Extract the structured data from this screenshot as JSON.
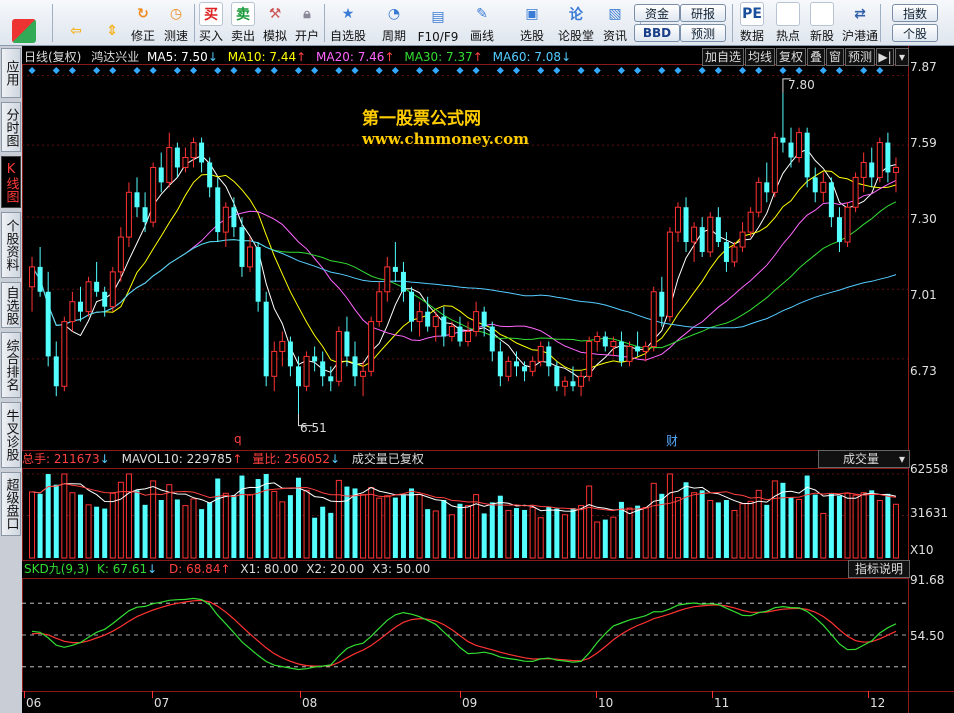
{
  "toolbar": {
    "buttons": [
      {
        "label": "",
        "icon": "grid-icon"
      },
      {
        "label": "",
        "icon": "back-arrow-icon"
      },
      {
        "label": "",
        "icon": "up-down-arrows-icon"
      },
      {
        "label": "修正",
        "icon": "refresh-icon"
      },
      {
        "label": "测速",
        "icon": "clock-icon"
      },
      {
        "label": "买入",
        "icon": "buy-icon",
        "glyph": "买"
      },
      {
        "label": "卖出",
        "icon": "sell-icon",
        "glyph": "卖"
      },
      {
        "label": "模拟",
        "icon": "hammer-icon"
      },
      {
        "label": "开户",
        "icon": "lock-icon"
      },
      {
        "label": "自选股",
        "icon": "star-folder-icon"
      },
      {
        "label": "周期",
        "icon": "period-icon"
      },
      {
        "label": "F10/F9",
        "icon": "f10-icon"
      },
      {
        "label": "画线",
        "icon": "pen-icon"
      },
      {
        "label": "选股",
        "icon": "screen-icon"
      },
      {
        "label": "论股堂",
        "icon": "forum-icon"
      },
      {
        "label": "资讯",
        "icon": "news-icon"
      },
      {
        "label": "数据",
        "icon": "pe-icon",
        "glyph": "PE"
      },
      {
        "label": "热点",
        "icon": "hot-icon"
      },
      {
        "label": "新股",
        "icon": "new-stock-icon"
      },
      {
        "label": "沪港通",
        "icon": "sse-hkex-icon"
      }
    ],
    "pills": {
      "fund": "资金",
      "bbd": "BBD",
      "research": "研报",
      "forecast": "预测",
      "index": "指数",
      "stock": "个股"
    }
  },
  "left_tabs": [
    {
      "label": "应用",
      "active": false
    },
    {
      "label": "分时图",
      "active": false
    },
    {
      "label": "K线图",
      "active": true
    },
    {
      "label": "个股资料",
      "active": false
    },
    {
      "label": "自选股",
      "active": false
    },
    {
      "label": "综合排名",
      "active": false
    },
    {
      "label": "牛叉诊股",
      "active": false
    },
    {
      "label": "超级盘口",
      "active": false
    }
  ],
  "header": {
    "period": "日线(复权)",
    "stock_name": "鸿达兴业",
    "ma5": "MA5: 7.50",
    "ma5_arrow": "↓",
    "ma10": "MA10: 7.44",
    "ma10_arrow": "↑",
    "ma20": "MA20: 7.46",
    "ma20_arrow": "↑",
    "ma30": "MA30: 7.37",
    "ma30_arrow": "↑",
    "ma60": "MA60: 7.08",
    "ma60_arrow": "↓",
    "buttons": [
      "加自选",
      "均线",
      "复权",
      "叠",
      "窗",
      "预测"
    ],
    "colors": {
      "ma5": "#ffffff",
      "ma10": "#ffff00",
      "ma20": "#ff66ff",
      "ma30": "#33dd33",
      "ma60": "#55ccff"
    }
  },
  "watermark": {
    "title": "第一股票公式网",
    "url": "www.chnmoney.com"
  },
  "price_panel": {
    "y_ticks": [
      "7.87",
      "7.59",
      "7.30",
      "7.01",
      "6.73"
    ],
    "high_label": "7.80",
    "low_label": "6.51",
    "markers": {
      "q": "q",
      "cai": "财"
    }
  },
  "volume_panel": {
    "total": "总手: 211673",
    "total_arrow": "↓",
    "mavol": "MAVOL10: 229785",
    "mavol_arrow": "↑",
    "ratio": "量比: 256052",
    "ratio_arrow": "↓",
    "note": "成交量已复权",
    "selector": "成交量",
    "y_ticks": [
      "62558",
      "31631"
    ],
    "unit": "X10"
  },
  "skd_panel": {
    "name": "SKD九(9,3)",
    "k": "K: 67.61",
    "k_arrow": "↓",
    "d": "D: 68.84",
    "d_arrow": "↑",
    "x1": "X1: 80.00",
    "x2": "X2: 20.00",
    "x3": "X3: 50.00",
    "explain": "指标说明",
    "y_ticks": [
      "91.68",
      "54.50"
    ]
  },
  "x_axis": [
    "06",
    "07",
    "08",
    "09",
    "10",
    "11",
    "12"
  ],
  "chart_data": {
    "type": "candlestick",
    "stock": "鸿达兴业",
    "price_range": [
      6.51,
      7.8
    ],
    "candles": [
      {
        "o": 7.02,
        "h": 7.14,
        "l": 6.92,
        "c": 7.1
      },
      {
        "o": 7.1,
        "h": 7.18,
        "l": 6.98,
        "c": 7.0
      },
      {
        "o": 7.0,
        "h": 7.08,
        "l": 6.7,
        "c": 6.74
      },
      {
        "o": 6.74,
        "h": 6.8,
        "l": 6.58,
        "c": 6.62
      },
      {
        "o": 6.62,
        "h": 6.9,
        "l": 6.6,
        "c": 6.88
      },
      {
        "o": 6.88,
        "h": 7.0,
        "l": 6.84,
        "c": 6.96
      },
      {
        "o": 6.96,
        "h": 7.02,
        "l": 6.88,
        "c": 6.92
      },
      {
        "o": 6.92,
        "h": 7.06,
        "l": 6.9,
        "c": 7.04
      },
      {
        "o": 7.04,
        "h": 7.12,
        "l": 6.98,
        "c": 7.0
      },
      {
        "o": 7.0,
        "h": 7.02,
        "l": 6.9,
        "c": 6.94
      },
      {
        "o": 6.94,
        "h": 7.1,
        "l": 6.92,
        "c": 7.08
      },
      {
        "o": 7.08,
        "h": 7.26,
        "l": 7.04,
        "c": 7.22
      },
      {
        "o": 7.22,
        "h": 7.44,
        "l": 7.18,
        "c": 7.4
      },
      {
        "o": 7.4,
        "h": 7.46,
        "l": 7.3,
        "c": 7.34
      },
      {
        "o": 7.34,
        "h": 7.4,
        "l": 7.24,
        "c": 7.28
      },
      {
        "o": 7.28,
        "h": 7.52,
        "l": 7.26,
        "c": 7.5
      },
      {
        "o": 7.5,
        "h": 7.56,
        "l": 7.4,
        "c": 7.44
      },
      {
        "o": 7.44,
        "h": 7.64,
        "l": 7.42,
        "c": 7.58
      },
      {
        "o": 7.58,
        "h": 7.6,
        "l": 7.46,
        "c": 7.5
      },
      {
        "o": 7.5,
        "h": 7.58,
        "l": 7.48,
        "c": 7.54
      },
      {
        "o": 7.54,
        "h": 7.62,
        "l": 7.5,
        "c": 7.6
      },
      {
        "o": 7.6,
        "h": 7.62,
        "l": 7.48,
        "c": 7.52
      },
      {
        "o": 7.52,
        "h": 7.54,
        "l": 7.38,
        "c": 7.42
      },
      {
        "o": 7.42,
        "h": 7.46,
        "l": 7.2,
        "c": 7.24
      },
      {
        "o": 7.24,
        "h": 7.36,
        "l": 7.18,
        "c": 7.34
      },
      {
        "o": 7.34,
        "h": 7.38,
        "l": 7.22,
        "c": 7.26
      },
      {
        "o": 7.26,
        "h": 7.3,
        "l": 7.06,
        "c": 7.1
      },
      {
        "o": 7.1,
        "h": 7.22,
        "l": 7.08,
        "c": 7.18
      },
      {
        "o": 7.18,
        "h": 7.2,
        "l": 6.92,
        "c": 6.96
      },
      {
        "o": 6.96,
        "h": 7.0,
        "l": 6.62,
        "c": 6.66
      },
      {
        "o": 6.66,
        "h": 6.8,
        "l": 6.6,
        "c": 6.76
      },
      {
        "o": 6.76,
        "h": 6.84,
        "l": 6.7,
        "c": 6.8
      },
      {
        "o": 6.8,
        "h": 6.82,
        "l": 6.66,
        "c": 6.7
      },
      {
        "o": 6.7,
        "h": 6.74,
        "l": 6.51,
        "c": 6.62
      },
      {
        "o": 6.62,
        "h": 6.76,
        "l": 6.6,
        "c": 6.74
      },
      {
        "o": 6.74,
        "h": 6.78,
        "l": 6.68,
        "c": 6.72
      },
      {
        "o": 6.72,
        "h": 6.76,
        "l": 6.62,
        "c": 6.66
      },
      {
        "o": 6.66,
        "h": 6.7,
        "l": 6.6,
        "c": 6.64
      },
      {
        "o": 6.64,
        "h": 6.86,
        "l": 6.62,
        "c": 6.84
      },
      {
        "o": 6.84,
        "h": 6.9,
        "l": 6.7,
        "c": 6.74
      },
      {
        "o": 6.74,
        "h": 6.8,
        "l": 6.62,
        "c": 6.66
      },
      {
        "o": 6.66,
        "h": 6.72,
        "l": 6.58,
        "c": 6.68
      },
      {
        "o": 6.68,
        "h": 6.9,
        "l": 6.66,
        "c": 6.88
      },
      {
        "o": 6.88,
        "h": 7.04,
        "l": 6.86,
        "c": 7.0
      },
      {
        "o": 7.0,
        "h": 7.14,
        "l": 6.96,
        "c": 7.1
      },
      {
        "o": 7.1,
        "h": 7.2,
        "l": 7.04,
        "c": 7.08
      },
      {
        "o": 7.08,
        "h": 7.12,
        "l": 6.96,
        "c": 7.0
      },
      {
        "o": 7.0,
        "h": 7.02,
        "l": 6.84,
        "c": 6.88
      },
      {
        "o": 6.88,
        "h": 6.96,
        "l": 6.82,
        "c": 6.92
      },
      {
        "o": 6.92,
        "h": 6.98,
        "l": 6.84,
        "c": 6.86
      },
      {
        "o": 6.86,
        "h": 6.92,
        "l": 6.8,
        "c": 6.9
      },
      {
        "o": 6.9,
        "h": 6.94,
        "l": 6.78,
        "c": 6.82
      },
      {
        "o": 6.82,
        "h": 6.88,
        "l": 6.8,
        "c": 6.86
      },
      {
        "o": 6.86,
        "h": 6.9,
        "l": 6.78,
        "c": 6.8
      },
      {
        "o": 6.8,
        "h": 6.88,
        "l": 6.78,
        "c": 6.84
      },
      {
        "o": 6.84,
        "h": 6.96,
        "l": 6.82,
        "c": 6.92
      },
      {
        "o": 6.92,
        "h": 6.94,
        "l": 6.82,
        "c": 6.86
      },
      {
        "o": 6.86,
        "h": 6.88,
        "l": 6.72,
        "c": 6.76
      },
      {
        "o": 6.76,
        "h": 6.8,
        "l": 6.62,
        "c": 6.66
      },
      {
        "o": 6.66,
        "h": 6.74,
        "l": 6.64,
        "c": 6.72
      },
      {
        "o": 6.72,
        "h": 6.76,
        "l": 6.66,
        "c": 6.7
      },
      {
        "o": 6.7,
        "h": 6.72,
        "l": 6.64,
        "c": 6.68
      },
      {
        "o": 6.68,
        "h": 6.74,
        "l": 6.66,
        "c": 6.72
      },
      {
        "o": 6.72,
        "h": 6.8,
        "l": 6.7,
        "c": 6.78
      },
      {
        "o": 6.78,
        "h": 6.8,
        "l": 6.66,
        "c": 6.7
      },
      {
        "o": 6.7,
        "h": 6.72,
        "l": 6.6,
        "c": 6.62
      },
      {
        "o": 6.62,
        "h": 6.66,
        "l": 6.58,
        "c": 6.64
      },
      {
        "o": 6.64,
        "h": 6.7,
        "l": 6.6,
        "c": 6.62
      },
      {
        "o": 6.62,
        "h": 6.68,
        "l": 6.58,
        "c": 6.66
      },
      {
        "o": 6.66,
        "h": 6.82,
        "l": 6.64,
        "c": 6.8
      },
      {
        "o": 6.8,
        "h": 6.84,
        "l": 6.76,
        "c": 6.82
      },
      {
        "o": 6.82,
        "h": 6.84,
        "l": 6.76,
        "c": 6.78
      },
      {
        "o": 6.78,
        "h": 6.82,
        "l": 6.74,
        "c": 6.8
      },
      {
        "o": 6.8,
        "h": 6.84,
        "l": 6.7,
        "c": 6.72
      },
      {
        "o": 6.72,
        "h": 6.8,
        "l": 6.7,
        "c": 6.78
      },
      {
        "o": 6.78,
        "h": 6.84,
        "l": 6.74,
        "c": 6.76
      },
      {
        "o": 6.76,
        "h": 6.8,
        "l": 6.72,
        "c": 6.78
      },
      {
        "o": 6.78,
        "h": 7.02,
        "l": 6.76,
        "c": 7.0
      },
      {
        "o": 7.0,
        "h": 7.06,
        "l": 6.86,
        "c": 6.9
      },
      {
        "o": 6.9,
        "h": 7.26,
        "l": 6.88,
        "c": 7.24
      },
      {
        "o": 7.24,
        "h": 7.36,
        "l": 7.2,
        "c": 7.34
      },
      {
        "o": 7.34,
        "h": 7.38,
        "l": 7.16,
        "c": 7.2
      },
      {
        "o": 7.2,
        "h": 7.28,
        "l": 7.12,
        "c": 7.26
      },
      {
        "o": 7.26,
        "h": 7.3,
        "l": 7.14,
        "c": 7.16
      },
      {
        "o": 7.16,
        "h": 7.32,
        "l": 7.14,
        "c": 7.3
      },
      {
        "o": 7.3,
        "h": 7.34,
        "l": 7.18,
        "c": 7.2
      },
      {
        "o": 7.2,
        "h": 7.24,
        "l": 7.08,
        "c": 7.12
      },
      {
        "o": 7.12,
        "h": 7.2,
        "l": 7.1,
        "c": 7.18
      },
      {
        "o": 7.18,
        "h": 7.28,
        "l": 7.16,
        "c": 7.24
      },
      {
        "o": 7.24,
        "h": 7.34,
        "l": 7.22,
        "c": 7.32
      },
      {
        "o": 7.32,
        "h": 7.46,
        "l": 7.3,
        "c": 7.44
      },
      {
        "o": 7.44,
        "h": 7.52,
        "l": 7.36,
        "c": 7.4
      },
      {
        "o": 7.4,
        "h": 7.64,
        "l": 7.38,
        "c": 7.62
      },
      {
        "o": 7.62,
        "h": 7.8,
        "l": 7.56,
        "c": 7.6
      },
      {
        "o": 7.6,
        "h": 7.66,
        "l": 7.5,
        "c": 7.54
      },
      {
        "o": 7.54,
        "h": 7.66,
        "l": 7.52,
        "c": 7.64
      },
      {
        "o": 7.64,
        "h": 7.66,
        "l": 7.42,
        "c": 7.46
      },
      {
        "o": 7.46,
        "h": 7.5,
        "l": 7.36,
        "c": 7.4
      },
      {
        "o": 7.4,
        "h": 7.48,
        "l": 7.36,
        "c": 7.44
      },
      {
        "o": 7.44,
        "h": 7.46,
        "l": 7.26,
        "c": 7.3
      },
      {
        "o": 7.3,
        "h": 7.34,
        "l": 7.16,
        "c": 7.2
      },
      {
        "o": 7.2,
        "h": 7.36,
        "l": 7.18,
        "c": 7.34
      },
      {
        "o": 7.34,
        "h": 7.48,
        "l": 7.32,
        "c": 7.46
      },
      {
        "o": 7.46,
        "h": 7.56,
        "l": 7.4,
        "c": 7.52
      },
      {
        "o": 7.52,
        "h": 7.58,
        "l": 7.42,
        "c": 7.46
      },
      {
        "o": 7.46,
        "h": 7.62,
        "l": 7.44,
        "c": 7.6
      },
      {
        "o": 7.6,
        "h": 7.64,
        "l": 7.44,
        "c": 7.48
      },
      {
        "o": 7.48,
        "h": 7.54,
        "l": 7.4,
        "c": 7.5
      }
    ],
    "volume_range": [
      0,
      62558
    ],
    "skd_range": [
      0,
      100
    ],
    "skd_levels": [
      80,
      50,
      20
    ]
  }
}
